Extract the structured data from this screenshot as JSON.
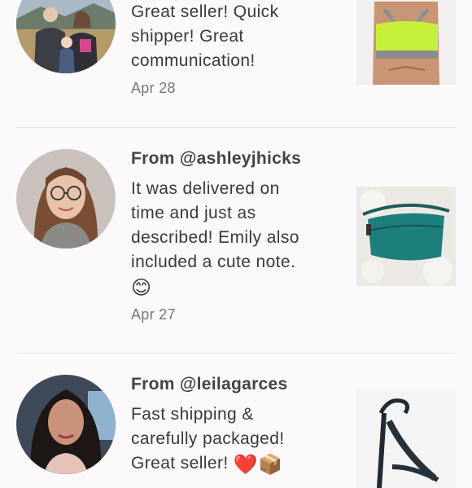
{
  "reviews": [
    {
      "from": "",
      "text_lines": [
        "Great seller! Quick",
        "shipper! Great",
        "communication!"
      ],
      "date": "Apr 28",
      "avatar_icon": "couple-with-child-photo",
      "item_icon": "neon-sports-bra-photo"
    },
    {
      "from": "From @ashleyjhicks",
      "text_lines": [
        "It was delivered on",
        "time and just as",
        "described! Emily also",
        "included a cute note."
      ],
      "emoji_line": "😊",
      "date": "Apr 27",
      "avatar_icon": "woman-with-glasses-photo",
      "item_icon": "teal-belt-bag-photo"
    },
    {
      "from": "From @leilagarces",
      "text_lines": [
        "Fast shipping &",
        "carefully packaged!"
      ],
      "last_line_text": "Great seller! ",
      "last_line_emojis": "❤️📦",
      "avatar_icon": "woman-portrait-photo",
      "item_icon": "black-heeled-sandal-photo"
    }
  ],
  "colors": {
    "background": "#fbf9fa",
    "text": "#3d3d3d",
    "date": "#777777",
    "divider": "#e7e3e4"
  }
}
